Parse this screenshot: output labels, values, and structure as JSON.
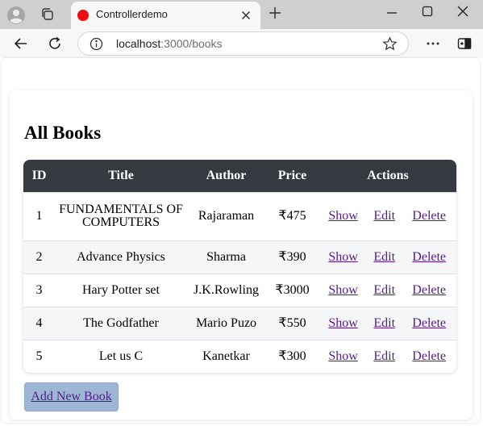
{
  "browser": {
    "tab_title": "Controllerdemo",
    "url_host": "localhost",
    "url_rest": ":3000/books"
  },
  "page": {
    "heading": "All Books",
    "table": {
      "headers": [
        "ID",
        "Title",
        "Author",
        "Price",
        "Actions"
      ],
      "rows": [
        {
          "id": "1",
          "title": "FUNDAMENTALS OF COMPUTERS",
          "author": "Rajaraman",
          "price": "₹475"
        },
        {
          "id": "2",
          "title": "Advance Physics",
          "author": "Sharma",
          "price": "₹390"
        },
        {
          "id": "3",
          "title": "Hary Potter set",
          "author": "J.K.Rowling",
          "price": "₹3000"
        },
        {
          "id": "4",
          "title": "The Godfather",
          "author": "Mario Puzo",
          "price": "₹550"
        },
        {
          "id": "5",
          "title": "Let us C",
          "author": "Kanetkar",
          "price": "₹300"
        }
      ],
      "actions": {
        "show": "Show",
        "edit": "Edit",
        "delete": "Delete"
      }
    },
    "add_button": "Add New Book"
  },
  "colors": {
    "table_header": "#343a40",
    "link": "#551a8b",
    "add_button_bg": "#9db6d6",
    "tab_favicon": "#ee0c0c"
  },
  "icons": [
    "profile-icon",
    "workspaces-icon",
    "close-icon",
    "plus-icon",
    "minimize-icon",
    "maximize-icon",
    "back-arrow-icon",
    "refresh-icon",
    "info-icon",
    "star-icon",
    "more-icon",
    "sidebar-icon"
  ]
}
